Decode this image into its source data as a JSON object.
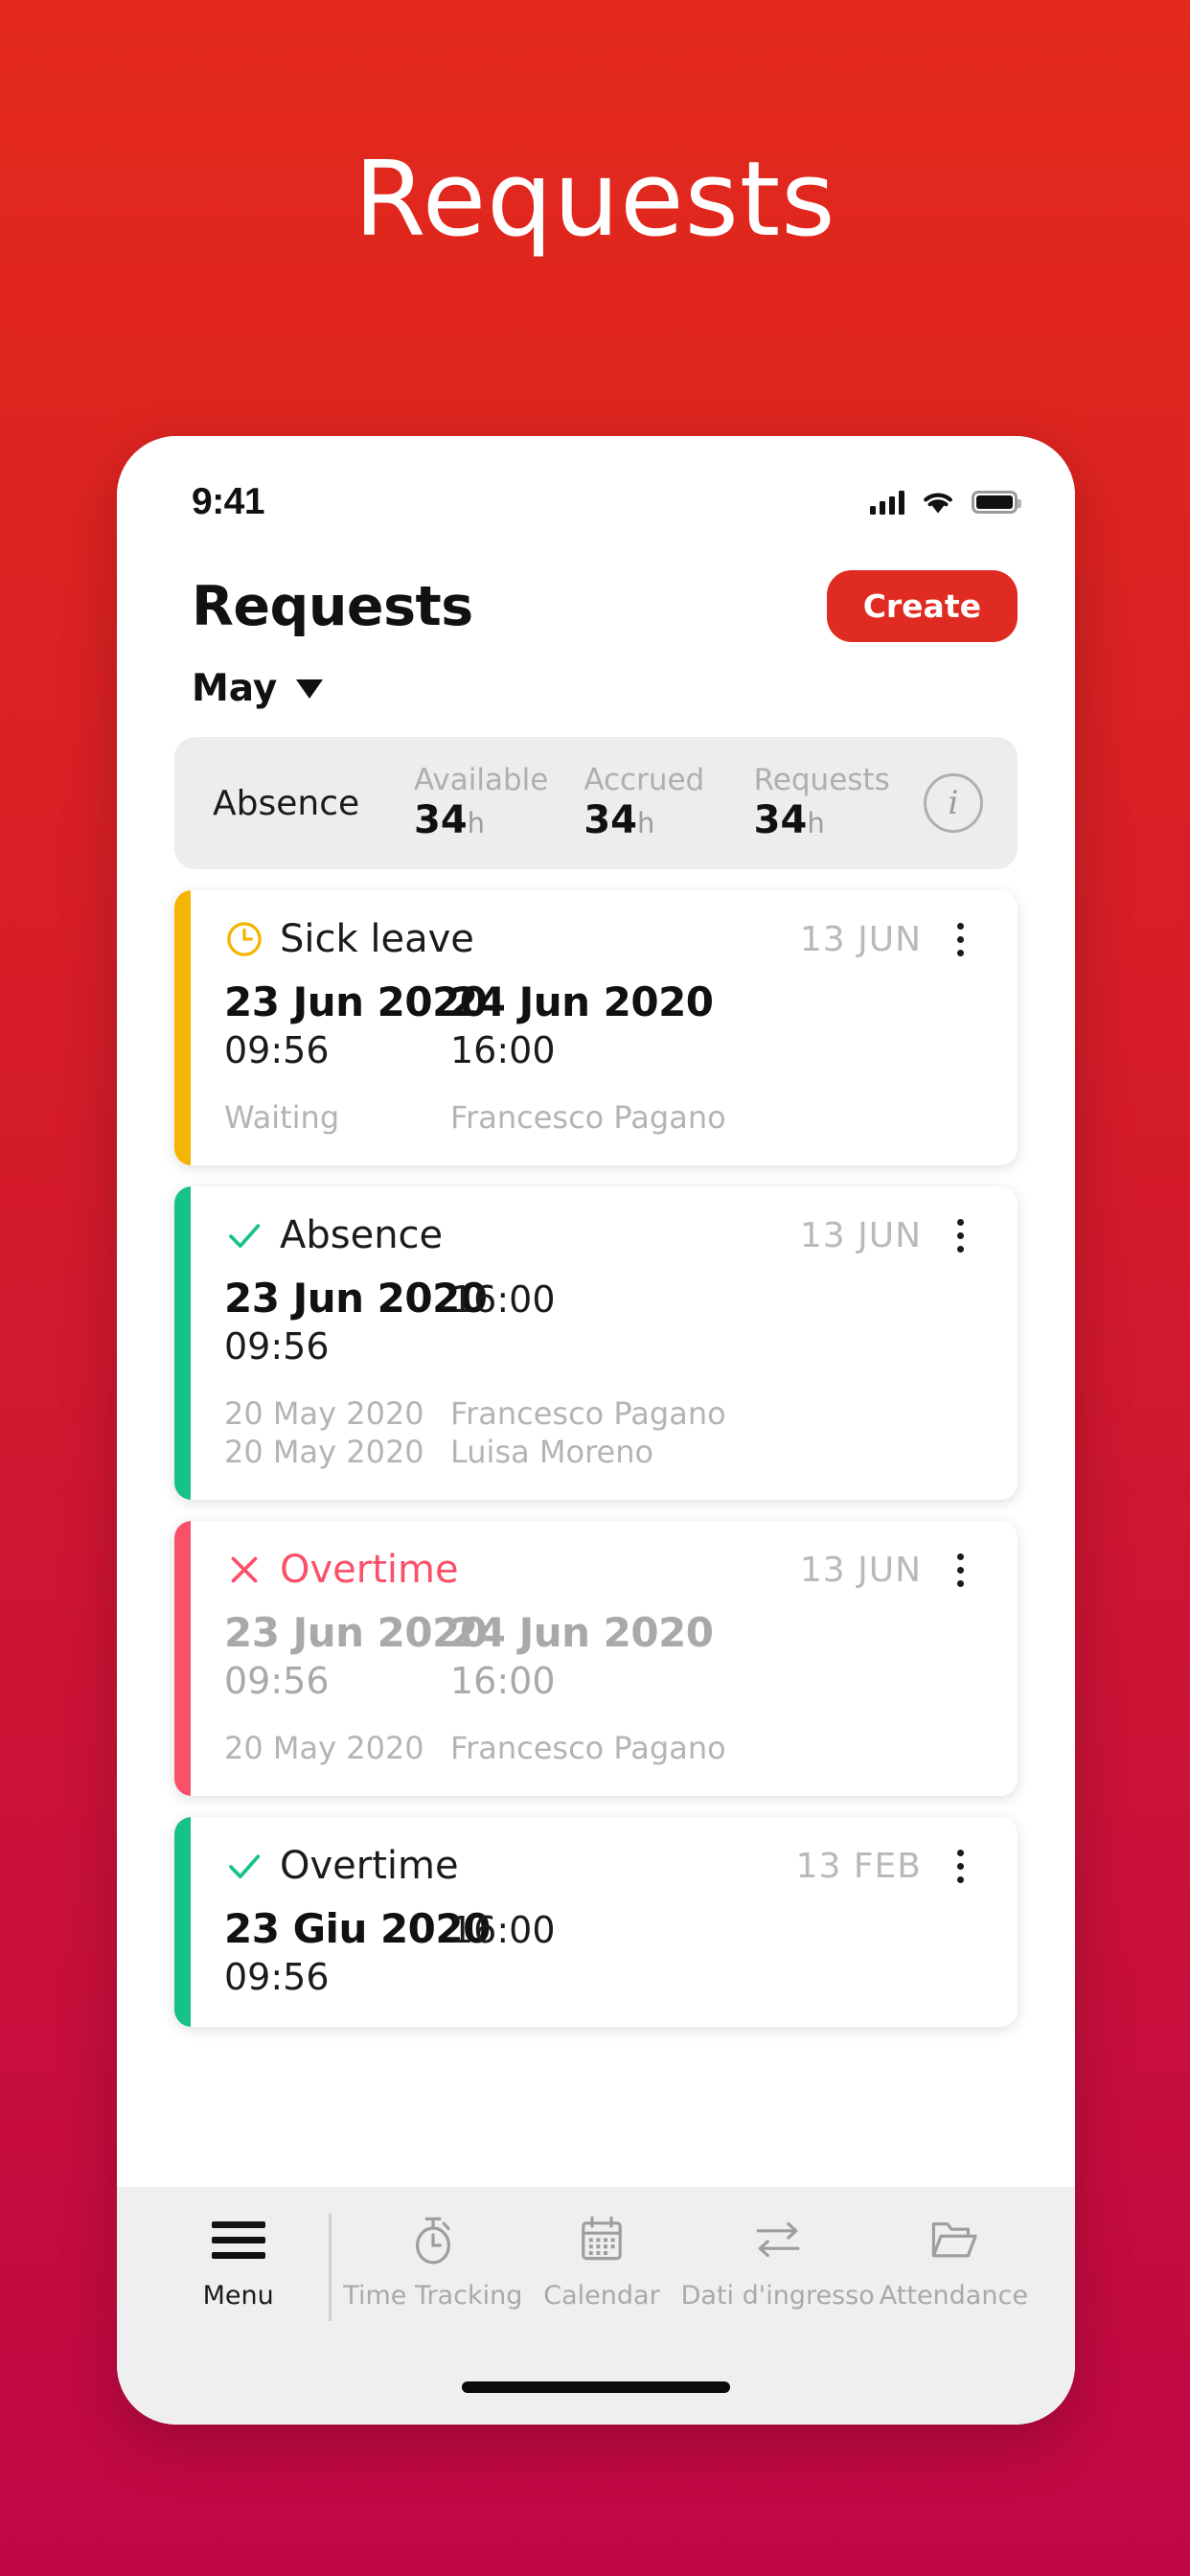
{
  "poster": {
    "title": "Requests"
  },
  "colors": {
    "brand_red": "#E02B22",
    "bg_gradient_top": "#E32A1C",
    "bg_gradient_bottom": "#BF0745",
    "status_waiting": "#F5B400",
    "status_approved": "#16C286",
    "status_rejected": "#FA5069"
  },
  "statusbar": {
    "time": "9:41",
    "icons": [
      "signal-bars-icon",
      "wifi-icon",
      "battery-icon"
    ]
  },
  "header": {
    "title": "Requests",
    "create_label": "Create",
    "month": "May",
    "month_caret": "chevron-down-icon"
  },
  "summary": {
    "title": "Absence",
    "info_icon": "info-icon",
    "columns": [
      {
        "label": "Available",
        "value": "34",
        "unit": "h"
      },
      {
        "label": "Accrued",
        "value": "34",
        "unit": "h"
      },
      {
        "label": "Requests",
        "value": "34",
        "unit": "h"
      }
    ]
  },
  "cards": [
    {
      "status": "waiting",
      "bar_color": "#F5B400",
      "icon": "clock-icon",
      "type": "Sick leave",
      "date_tag": "13 JUN",
      "start_date": "23 Jun 2020",
      "start_time": "09:56",
      "end_date": "24 Jun 2020",
      "end_time": "16:00",
      "footer": [
        {
          "left": "Waiting",
          "right": "Francesco Pagano"
        }
      ]
    },
    {
      "status": "approved",
      "bar_color": "#16C286",
      "icon": "check-icon",
      "type": "Absence",
      "date_tag": "13 JUN",
      "start_date": "23 Jun 2020",
      "start_time": "09:56",
      "end_date": "",
      "end_time": "16:00",
      "footer": [
        {
          "left": "20 May 2020",
          "right": "Francesco Pagano"
        },
        {
          "left": "20 May 2020",
          "right": "Luisa Moreno"
        }
      ]
    },
    {
      "status": "rejected",
      "bar_color": "#FA5069",
      "icon": "close-x-icon",
      "type": "Overtime",
      "date_tag": "13 JUN",
      "start_date": "23 Jun 2020",
      "start_time": "09:56",
      "end_date": "24 Jun 2020",
      "end_time": "16:00",
      "footer": [
        {
          "left": "20 May 2020",
          "right": "Francesco Pagano"
        }
      ]
    },
    {
      "status": "approved",
      "bar_color": "#16C286",
      "icon": "check-icon",
      "type": "Overtime",
      "date_tag": "13 FEB",
      "start_date": "23 Giu 2020",
      "start_time": "09:56",
      "end_date": "",
      "end_time": "16:00",
      "footer": []
    }
  ],
  "tabbar": {
    "items": [
      {
        "label": "Menu",
        "icon": "hamburger-menu-icon",
        "active": true
      },
      {
        "label": "Time Tracking",
        "icon": "stopwatch-icon",
        "active": false
      },
      {
        "label": "Calendar",
        "icon": "calendar-icon",
        "active": false
      },
      {
        "label": "Dati d'ingresso",
        "icon": "transfer-arrows-icon",
        "active": false
      },
      {
        "label": "Attendance",
        "icon": "open-folder-icon",
        "active": false
      }
    ]
  },
  "home_indicator": "home-indicator"
}
